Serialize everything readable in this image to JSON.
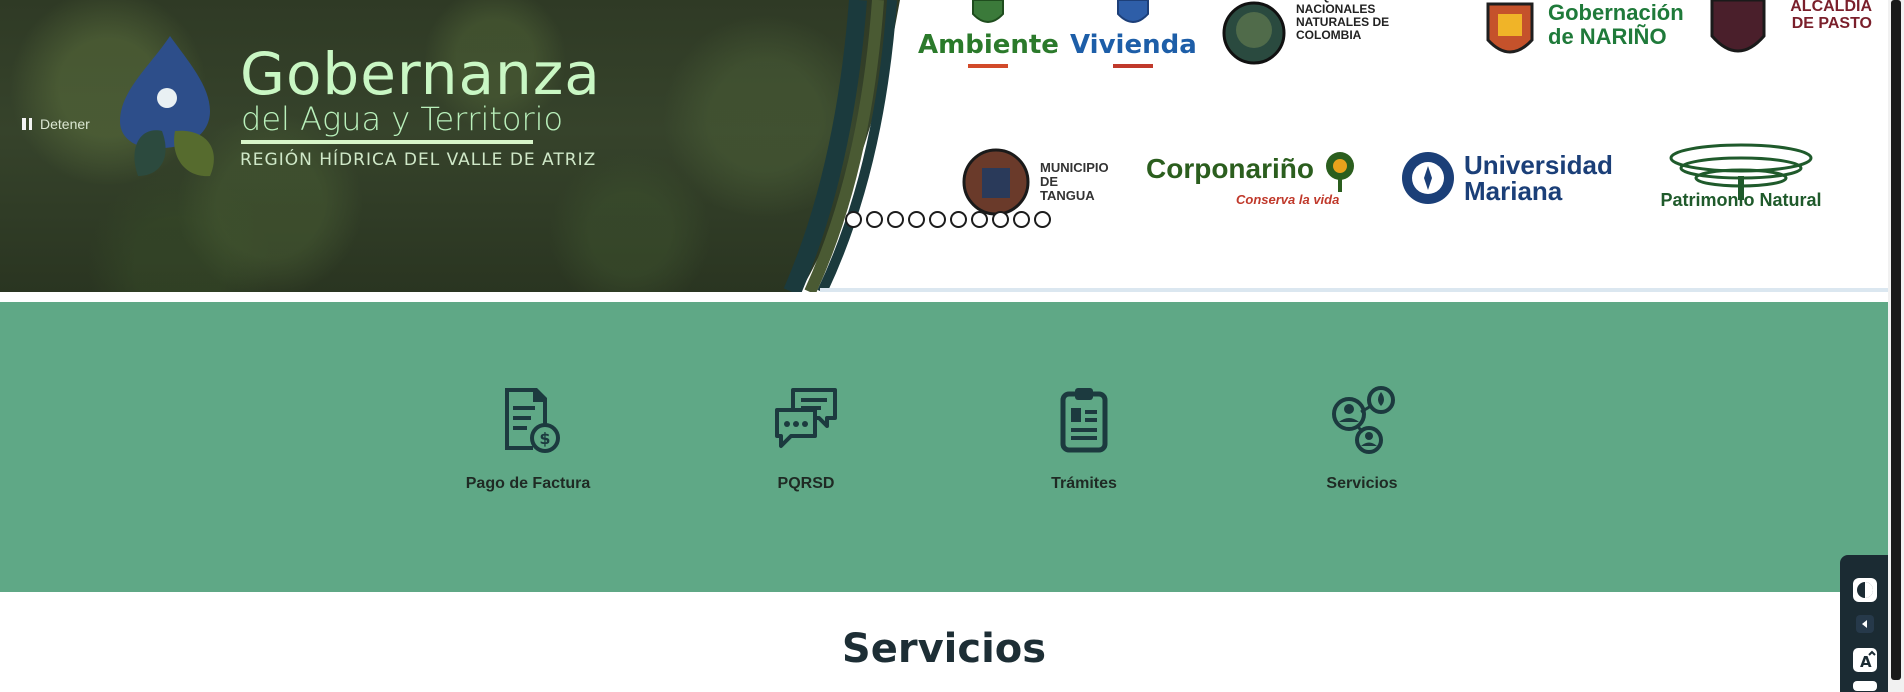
{
  "hero": {
    "brand_title": "Gobernanza",
    "brand_subtitle": "del Agua y Territorio",
    "brand_region": "REGIÓN HÍDRICA DEL VALLE DE ATRIZ",
    "pause_label": "Detener",
    "slide_count": 10,
    "logos_row1": [
      {
        "name": "Ambiente",
        "color": "#2b7a2b"
      },
      {
        "name": "Vivienda",
        "color": "#1d5ea8"
      },
      {
        "name": "PARQUES NACIONALES NATURALES DE COLOMBIA",
        "color": "#222222"
      },
      {
        "name": "Gobernación de NARIÑO",
        "color": "#1f7a3a"
      },
      {
        "name": "ALCALDÍA DE PASTO",
        "color": "#7a1f2b"
      }
    ],
    "logos_row2": [
      {
        "name": "MUNICIPIO DE TANGUA",
        "color": "#333333"
      },
      {
        "name": "Corponariño",
        "color": "#2b5e1e"
      },
      {
        "name": "Conserva la vida",
        "color": "#c0392b"
      },
      {
        "name": "Universidad Mariana",
        "color": "#1b3f78"
      },
      {
        "name": "Patrimonio Natural",
        "color": "#1f5a2b"
      }
    ]
  },
  "quick_access": [
    {
      "label": "Pago de Factura",
      "icon": "invoice-payment-icon"
    },
    {
      "label": "PQRSD",
      "icon": "chat-bubbles-icon"
    },
    {
      "label": "Trámites",
      "icon": "clipboard-document-icon"
    },
    {
      "label": "Servicios",
      "icon": "users-services-icon"
    }
  ],
  "services": {
    "title": "Servicios"
  },
  "colors": {
    "quick_bar_bg": "#5fa886",
    "icon_color": "#1c3a3f",
    "title_color": "#1d2e35",
    "a11y_widget_bg": "#1b2b33"
  }
}
